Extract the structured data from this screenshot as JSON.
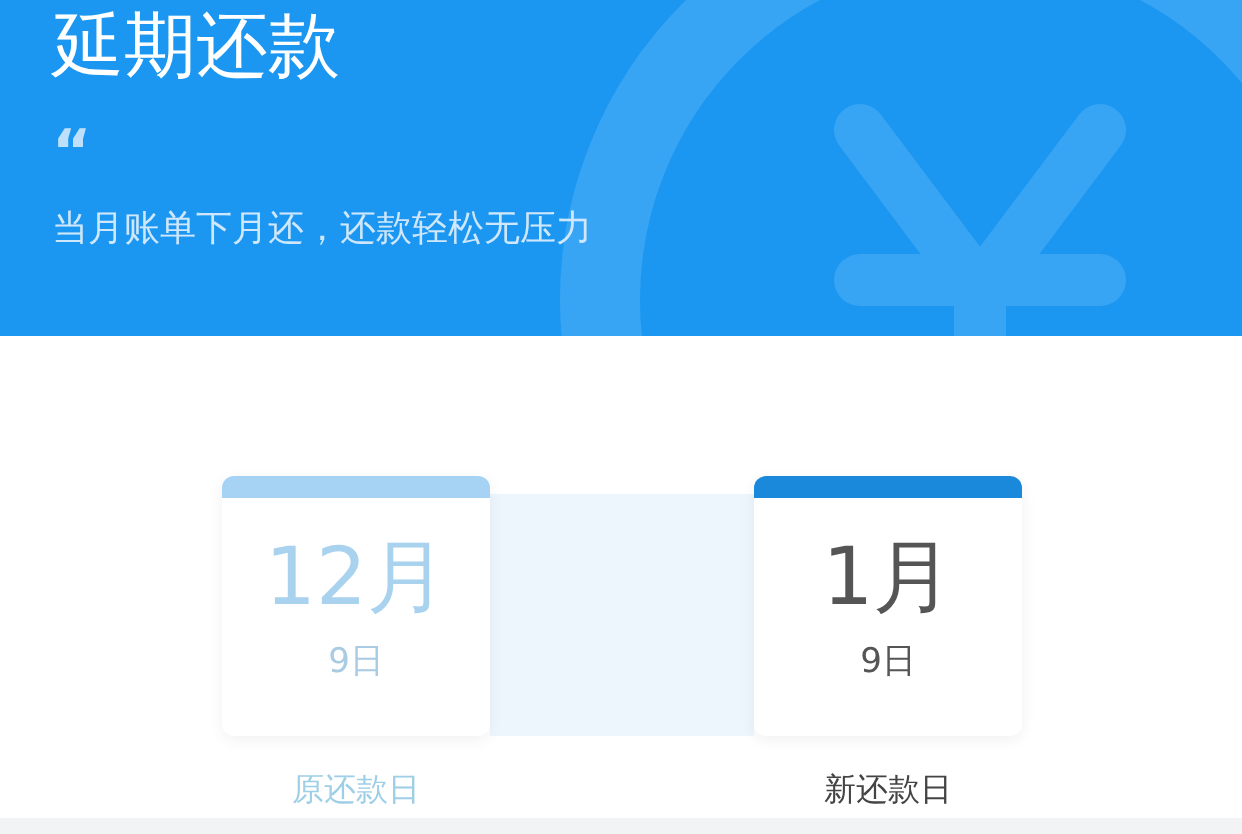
{
  "header": {
    "title": "延期还款",
    "quote_mark": "“",
    "subtitle": "当月账单下月还，还款轻松无压力"
  },
  "dates": [
    {
      "kind": "original",
      "month": "12月",
      "day": "9日",
      "label": "原还款日"
    },
    {
      "kind": "new",
      "month": "1月",
      "day": "9日",
      "label": "新还款日"
    }
  ]
}
